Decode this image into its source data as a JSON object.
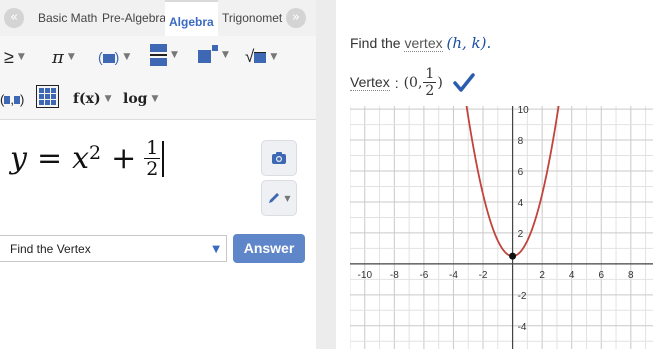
{
  "tabs": {
    "back_arrow": "«",
    "forward_arrow": "»",
    "items": [
      {
        "label": "Basic Math"
      },
      {
        "label": "Pre-Algebra"
      },
      {
        "label": "Algebra"
      },
      {
        "label": "Trigonomet"
      }
    ],
    "active": "Algebra"
  },
  "toolbar": {
    "row1": [
      {
        "icon": "greater-equal-icon",
        "glyph": "≥"
      },
      {
        "icon": "pi-icon",
        "glyph": "π"
      },
      {
        "icon": "parentheses-icon",
        "glyph": "(■)"
      },
      {
        "icon": "fraction-icon",
        "glyph": ""
      },
      {
        "icon": "exponent-icon",
        "glyph": ""
      },
      {
        "icon": "square-root-icon",
        "glyph": "√"
      }
    ],
    "row2": [
      {
        "icon": "ordered-pair-icon",
        "glyph": "(■,■)"
      },
      {
        "icon": "matrix-icon",
        "glyph": ""
      },
      {
        "icon": "function-icon",
        "glyph": "f(x)"
      },
      {
        "icon": "log-icon",
        "glyph": "log"
      }
    ],
    "caret": "▼"
  },
  "input": {
    "lhs": "y",
    "equals": "=",
    "base": "x",
    "exponent": "2",
    "plus": "+",
    "frac_num": "1",
    "frac_den": "2"
  },
  "action": {
    "select_value": "Find the Vertex",
    "answer_label": "Answer"
  },
  "result": {
    "prompt_prefix": "Find the",
    "prompt_link": "vertex",
    "prompt_math": "(h, k)",
    "prompt_suffix": ".",
    "vertex_label": "Vertex",
    "vertex_colon": ":",
    "vertex_open": "(0,",
    "vertex_num": "1",
    "vertex_den": "2",
    "vertex_close": ")",
    "check_color": "#2a5db0"
  },
  "graph": {
    "x_ticks": [
      -10,
      -8,
      -6,
      -4,
      -2,
      2,
      4,
      6,
      8
    ],
    "y_ticks": [
      10,
      8,
      6,
      4,
      2,
      -2,
      -4
    ],
    "x_range": [
      -11,
      9.5
    ],
    "y_range": [
      -5.5,
      10.2
    ],
    "curve_color": "#c0443c",
    "vertex": [
      0,
      0.5
    ],
    "function": "y = x^2 + 1/2"
  }
}
